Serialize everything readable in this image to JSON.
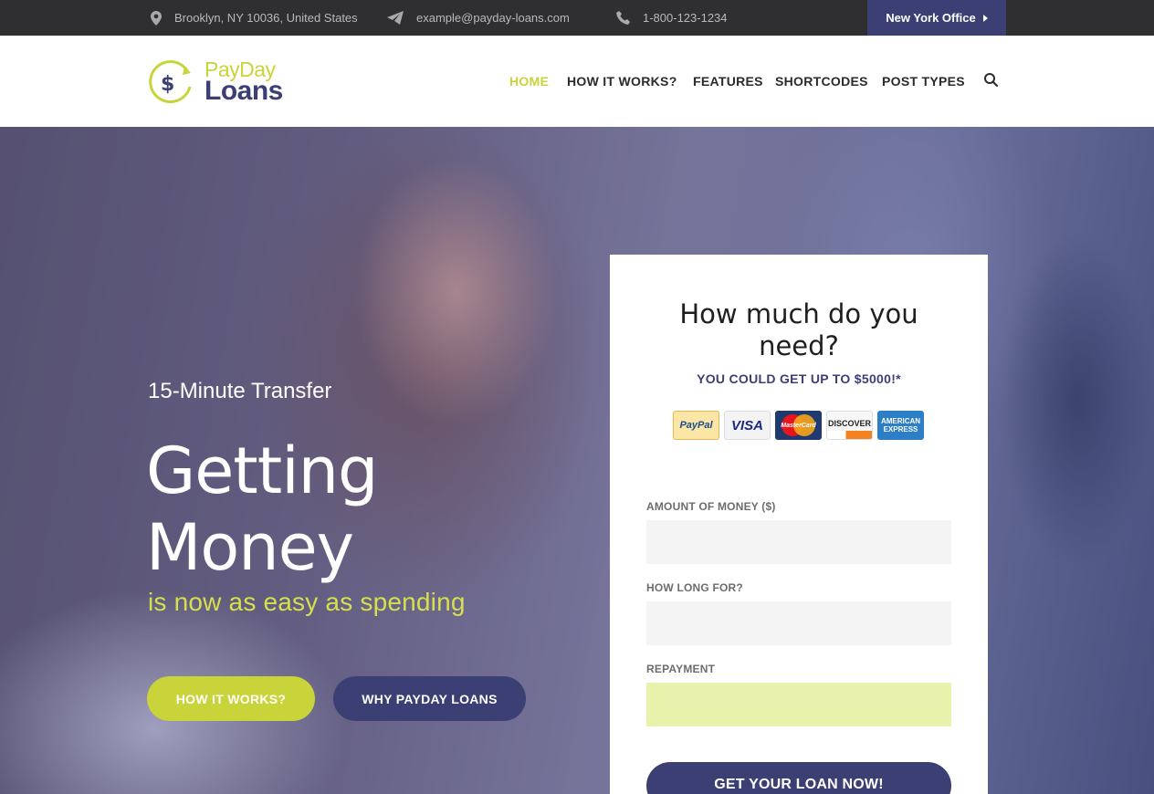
{
  "topbar": {
    "address": "Brooklyn, NY 10036, United States",
    "email": "example@payday-loans.com",
    "phone": "1-800-123-1234",
    "office_button": "New York Office"
  },
  "header": {
    "logo_line1": "PayDay",
    "logo_line2": "Loans",
    "nav": [
      {
        "label": "HOME",
        "active": true
      },
      {
        "label": "HOW IT WORKS?",
        "active": false
      },
      {
        "label": "FEATURES",
        "active": false
      },
      {
        "label": "SHORTCODES",
        "active": false
      },
      {
        "label": "POST TYPES",
        "active": false
      }
    ]
  },
  "hero": {
    "tagline": "15-Minute Transfer",
    "headline_line1": "Getting",
    "headline_line2": "Money",
    "subheadline": "is now as easy as spending",
    "button_primary": "HOW IT WORKS?",
    "button_secondary": "WHY PAYDAY LOANS"
  },
  "form": {
    "title_line1": "How much do you",
    "title_line2": "need?",
    "subtitle": "YOU COULD GET UP TO $5000!*",
    "payment_cards": [
      {
        "name": "PayPal",
        "icon": "paypal-icon"
      },
      {
        "name": "VISA",
        "icon": "visa-icon"
      },
      {
        "name": "MasterCard",
        "icon": "mastercard-icon"
      },
      {
        "name": "DISCOVER",
        "icon": "discover-icon"
      },
      {
        "name": "AMERICAN EXPRESS",
        "icon": "amex-icon"
      }
    ],
    "amount_label": "AMOUNT OF MONEY ($)",
    "amount_value": "",
    "duration_label": "HOW LONG FOR?",
    "duration_value": "",
    "repayment_label": "REPAYMENT",
    "repayment_value": "",
    "submit_label": "GET YOUR LOAN NOW!"
  },
  "colors": {
    "accent": "#c9d33a",
    "brand_navy": "#3b3f74",
    "topbar_bg": "#2f2f32"
  }
}
